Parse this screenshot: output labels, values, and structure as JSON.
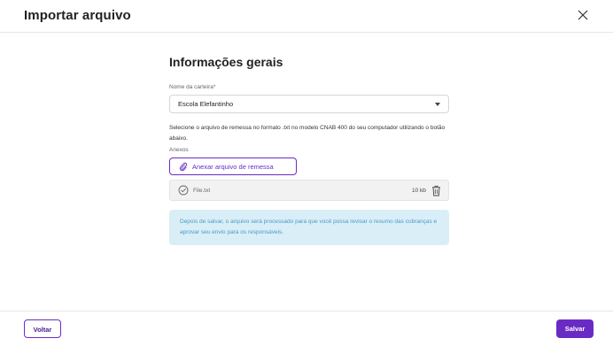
{
  "header": {
    "title": "Importar arquivo"
  },
  "section": {
    "title": "Informações gerais"
  },
  "wallet_field": {
    "label": "Nome da carteira*",
    "value": "Escola Elefantinho"
  },
  "help": {
    "text": "Selecione o arquivo de remessa no formato .txt no modelo CNAB 400 do seu computador utilizando o botão abaixo."
  },
  "attachments": {
    "label": "Anexos",
    "button_label": "Anexar arquivo de remessa",
    "file": {
      "name": "File.txt",
      "size": "10 kb"
    }
  },
  "info": {
    "text": "Depois de salvar, o arquivo será processado para que você possa revisar o resumo das cobranças e aprovar seu envio para os responsáveis."
  },
  "footer": {
    "back_label": "Voltar",
    "save_label": "Salvar"
  },
  "colors": {
    "accent": "#6a2bc4",
    "info_bg": "#d9eef7",
    "info_text": "#4a9ac9"
  }
}
